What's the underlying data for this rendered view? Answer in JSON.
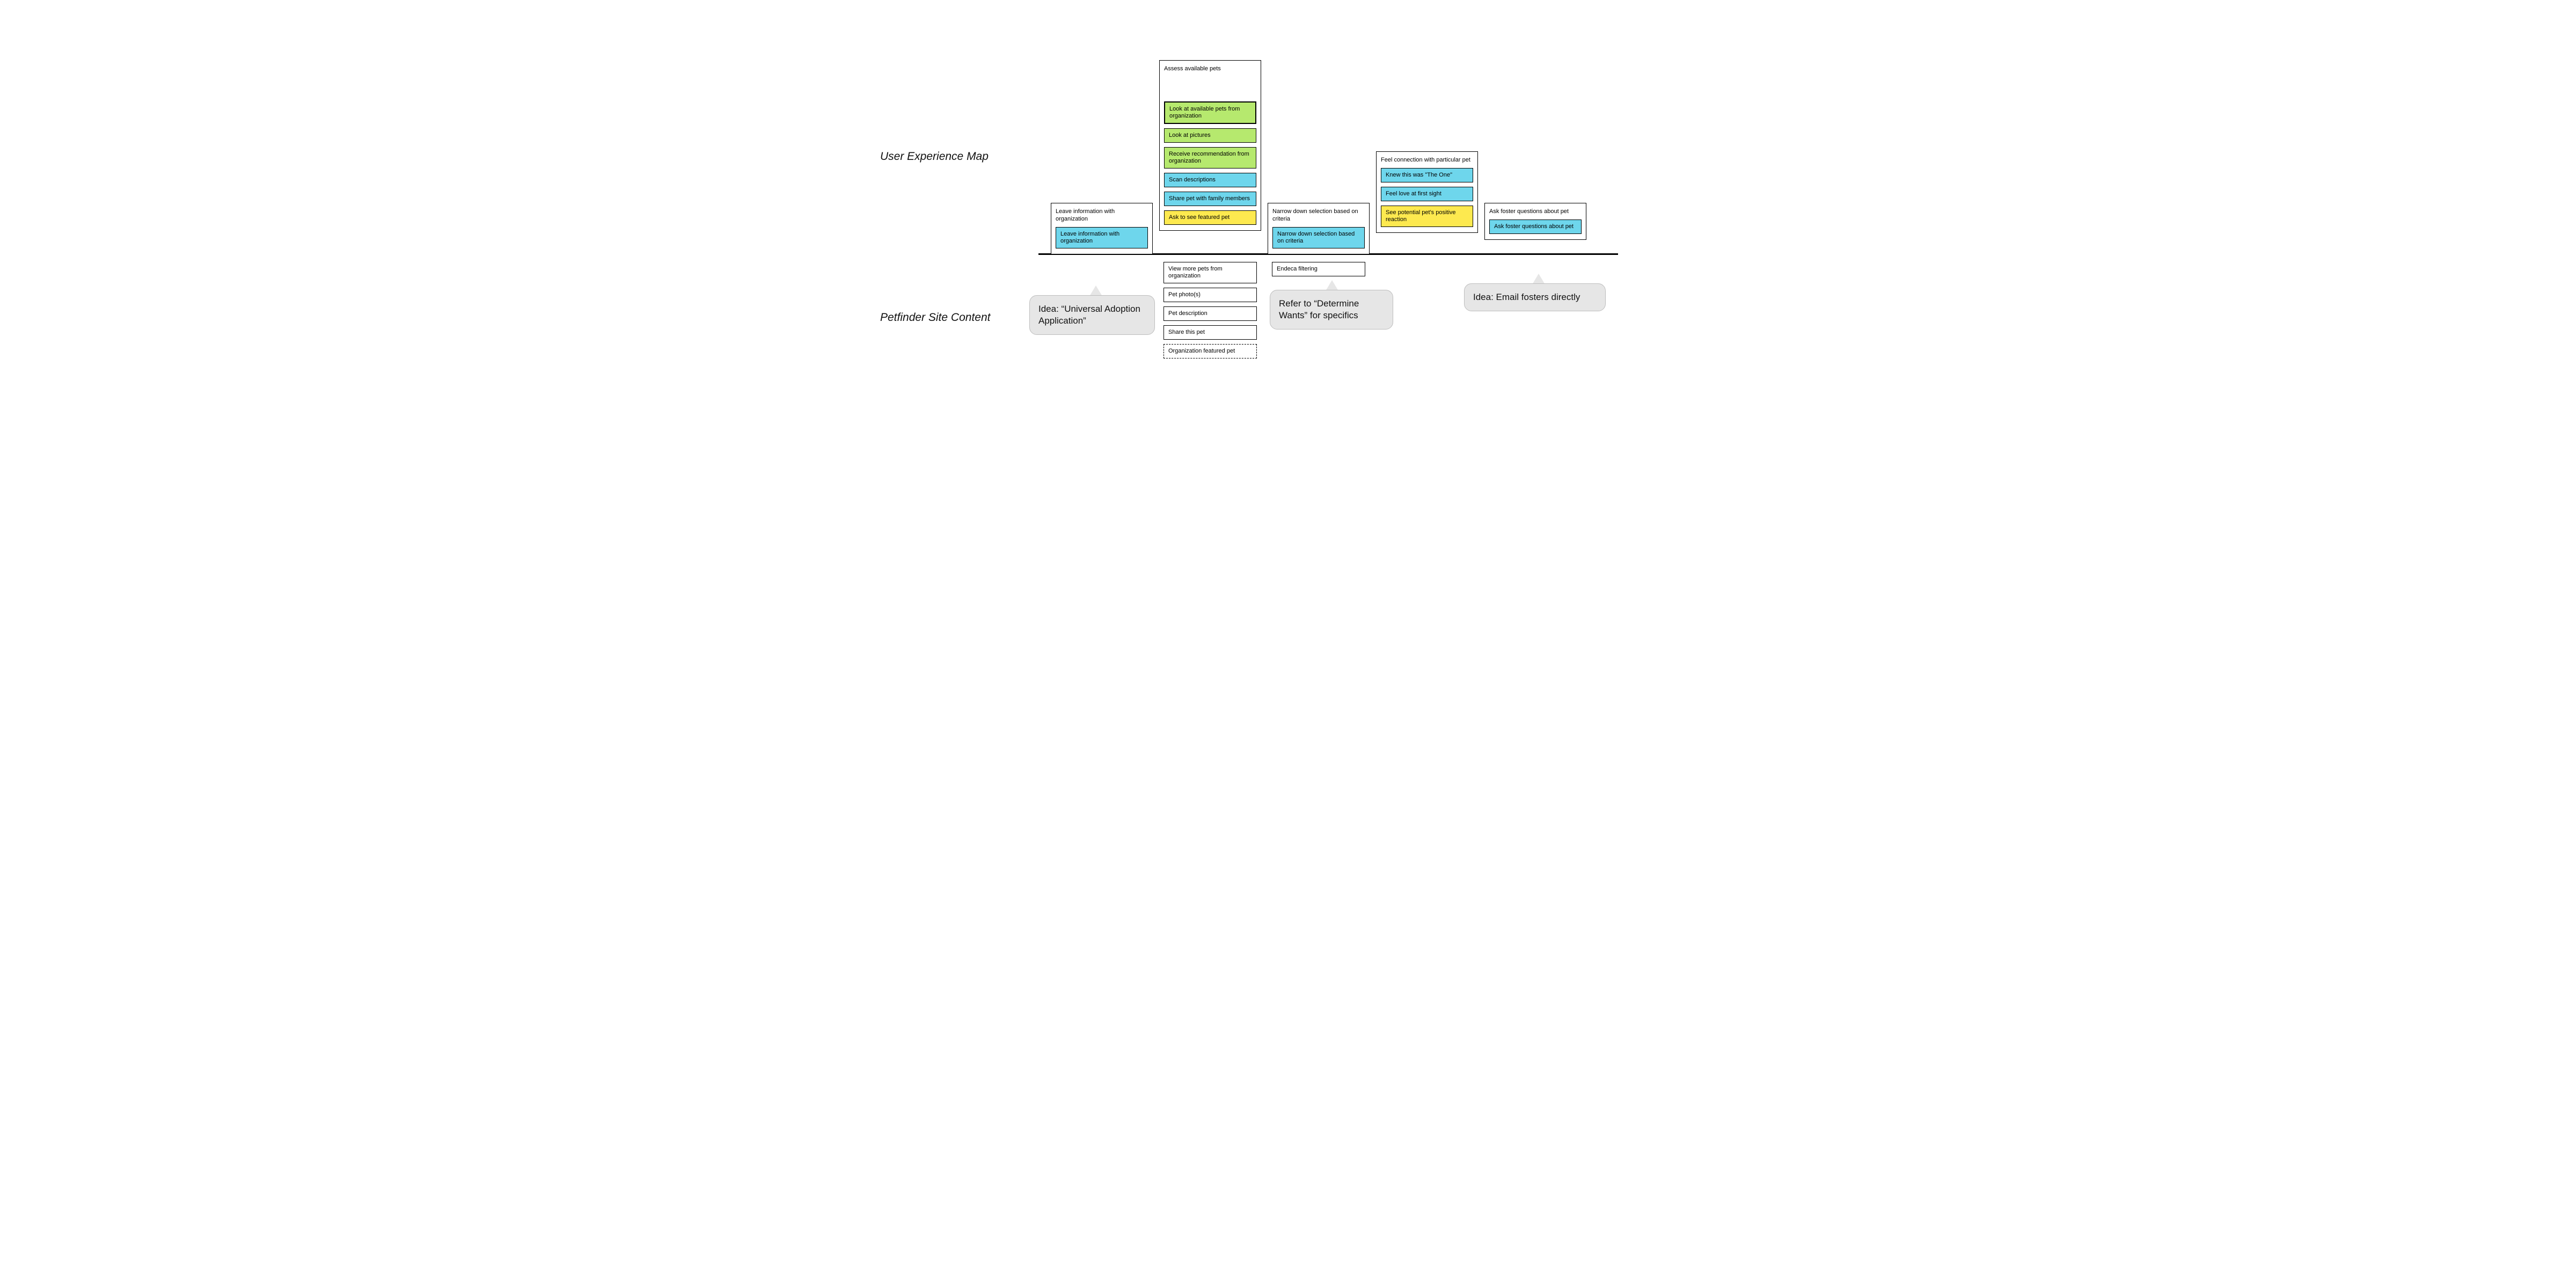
{
  "labels": {
    "ux_map": "User Experience Map",
    "site_content": "Petfinder Site Content"
  },
  "groups": {
    "g1": {
      "title": "Leave information with organization",
      "items": [
        {
          "text": "Leave information with organization",
          "color": "blue"
        }
      ]
    },
    "g2": {
      "title": "Assess available pets",
      "items": [
        {
          "text": "Look at available pets from organization",
          "color": "green",
          "thick": true
        },
        {
          "text": "Look at pictures",
          "color": "green"
        },
        {
          "text": "Receive recommendation from organization",
          "color": "green"
        },
        {
          "text": "Scan descriptions",
          "color": "blue"
        },
        {
          "text": "Share pet with family members",
          "color": "blue"
        },
        {
          "text": "Ask to see featured pet",
          "color": "yellow"
        }
      ]
    },
    "g3": {
      "title": "Narrow down selection based on criteria",
      "items": [
        {
          "text": "Narrow down selection based on criteria",
          "color": "blue"
        }
      ]
    },
    "g4": {
      "title": "Feel connection with particular pet",
      "items": [
        {
          "text": "Knew this was \"The One\"",
          "color": "blue"
        },
        {
          "text": "Feel love at first sight",
          "color": "blue"
        },
        {
          "text": "See potential pet's positive reaction",
          "color": "yellow"
        }
      ]
    },
    "g5": {
      "title": "Ask foster questions about pet",
      "items": [
        {
          "text": "Ask foster questions about pet",
          "color": "blue"
        }
      ]
    }
  },
  "site": {
    "col_assess": [
      {
        "text": "View more pets from organization"
      },
      {
        "text": "Pet photo(s)"
      },
      {
        "text": "Pet description"
      },
      {
        "text": "Share this pet"
      },
      {
        "text": "Organization featured pet",
        "dashed": true
      }
    ],
    "col_narrow": [
      {
        "text": "Endeca filtering"
      }
    ]
  },
  "bubbles": {
    "b1": "Idea: “Universal Adoption Application”",
    "b2": "Refer to “Determine Wants” for specifics",
    "b3": "Idea: Email fosters directly"
  }
}
